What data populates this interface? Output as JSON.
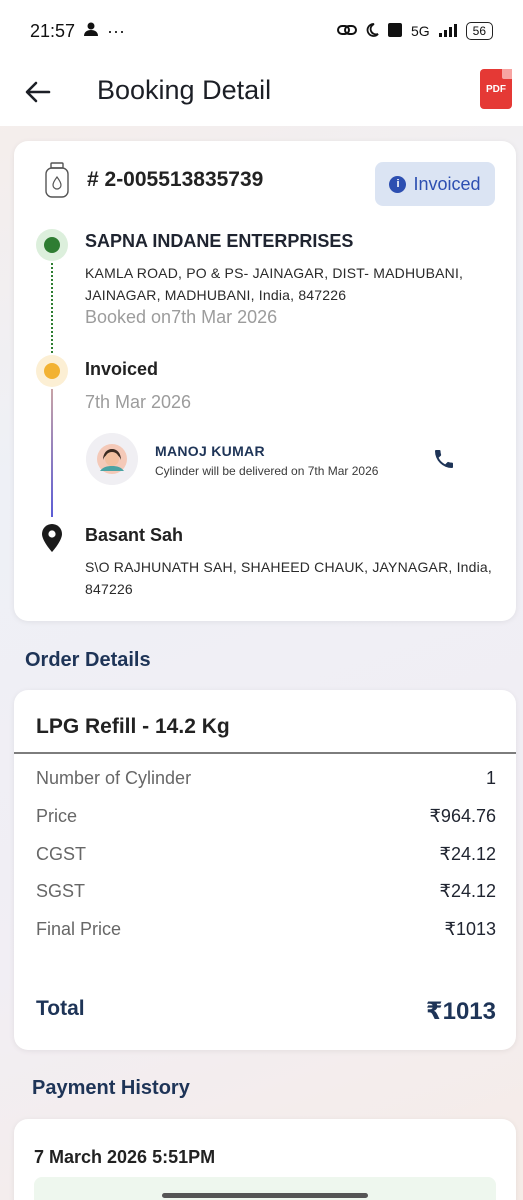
{
  "status_bar": {
    "time": "21:57",
    "network": "5G",
    "battery": "56"
  },
  "header": {
    "title": "Booking Detail",
    "pdf_label": "PDF"
  },
  "booking": {
    "order_number": "# 2-005513835739",
    "status_badge": "Invoiced",
    "distributor": {
      "name": "SAPNA INDANE ENTERPRISES",
      "address": "KAMLA ROAD, PO & PS- JAINAGAR, DIST- MADHUBANI, JAINAGAR, MADHUBANI, India, 847226",
      "booked_on": "Booked on7th Mar 2026"
    },
    "invoice": {
      "label": "Invoiced",
      "date": "7th Mar 2026"
    },
    "delivery_agent": {
      "name": "MANOJ KUMAR",
      "note": "Cylinder will be delivered on 7th Mar 2026"
    },
    "customer": {
      "name": "Basant Sah",
      "address": "S\\O RAJHUNATH SAH, SHAHEED CHAUK, JAYNAGAR, India, 847226"
    }
  },
  "order_details": {
    "title": "Order Details",
    "product": "LPG Refill - 14.2 Kg",
    "rows": [
      {
        "label": "Number of Cylinder",
        "value": "1"
      },
      {
        "label": "Price",
        "value": "₹964.76"
      },
      {
        "label": "CGST",
        "value": "₹24.12"
      },
      {
        "label": "SGST",
        "value": "₹24.12"
      },
      {
        "label": "Final Price",
        "value": "₹1013"
      }
    ],
    "total_label": "Total",
    "total_value": "₹1013"
  },
  "payment_history": {
    "title": "Payment History",
    "entries": [
      {
        "datetime": "7 March 2026 5:51PM"
      }
    ]
  },
  "colors": {
    "primary_navy": "#1e3457",
    "badge_bg": "#dbe4f3",
    "badge_text": "#2d4fb1",
    "green": "#2e7d32",
    "yellow": "#f2b233",
    "pdf_red": "#e53935"
  }
}
